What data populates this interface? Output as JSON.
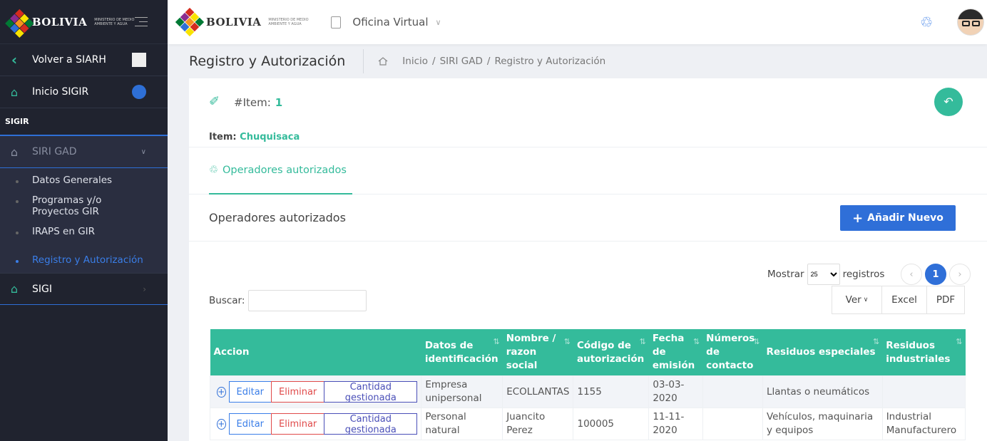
{
  "brand": {
    "name": "BOLIVIA",
    "subtitle": "MINISTERIO DE MEDIO AMBIENTE Y AGUA"
  },
  "sidebar": {
    "back": "Volver a SIARH",
    "home": "Inicio SIGIR",
    "section": "SIGIR",
    "group": "SIRI GAD",
    "children": [
      "Datos Generales",
      "Programas y/o Proyectos GIR",
      "IRAPS en GIR",
      "Registro y Autorización"
    ],
    "other": "SIGI"
  },
  "topbar": {
    "office": "Oficina Virtual"
  },
  "page": {
    "title": "Registro y Autorización",
    "breadcrumb": [
      "Inicio",
      "SIRI GAD",
      "Registro y Autorización"
    ]
  },
  "item": {
    "label": "#Item:",
    "number": "1",
    "name_label": "Item:",
    "name": "Chuquisaca"
  },
  "tab": {
    "label": "Operadores autorizados"
  },
  "section": {
    "title": "Operadores autorizados",
    "add_button": "Añadir Nuevo"
  },
  "table_controls": {
    "show_label": "Mostrar",
    "show_value": "25",
    "records_label": "registros",
    "search_label": "Buscar:",
    "search_value": "",
    "page": "1",
    "export": [
      "Ver",
      "Excel",
      "PDF"
    ]
  },
  "table": {
    "headers": [
      "Accion",
      "Datos de identificación",
      "Nombre / razon social",
      "Código de autorización",
      "Fecha de emisión",
      "Números de contacto",
      "Residuos especiales",
      "Residuos industriales"
    ],
    "action_buttons": [
      "Editar",
      "Eliminar",
      "Cantidad gestionada"
    ],
    "rows": [
      [
        "Empresa unipersonal",
        "ECOLLANTAS",
        "1155",
        "03-03-2020",
        "",
        "Llantas o neumáticos",
        ""
      ],
      [
        "Personal natural",
        "Juancito Perez",
        "100005",
        "11-11-2020",
        "",
        "Vehículos, maquinaria y equipos",
        "Industrial Manufacturero"
      ]
    ]
  },
  "colors": {
    "accent": "#34bb9b",
    "primary": "#2f6fd8",
    "danger": "#e04a4a",
    "sidebar": "#20232f"
  }
}
